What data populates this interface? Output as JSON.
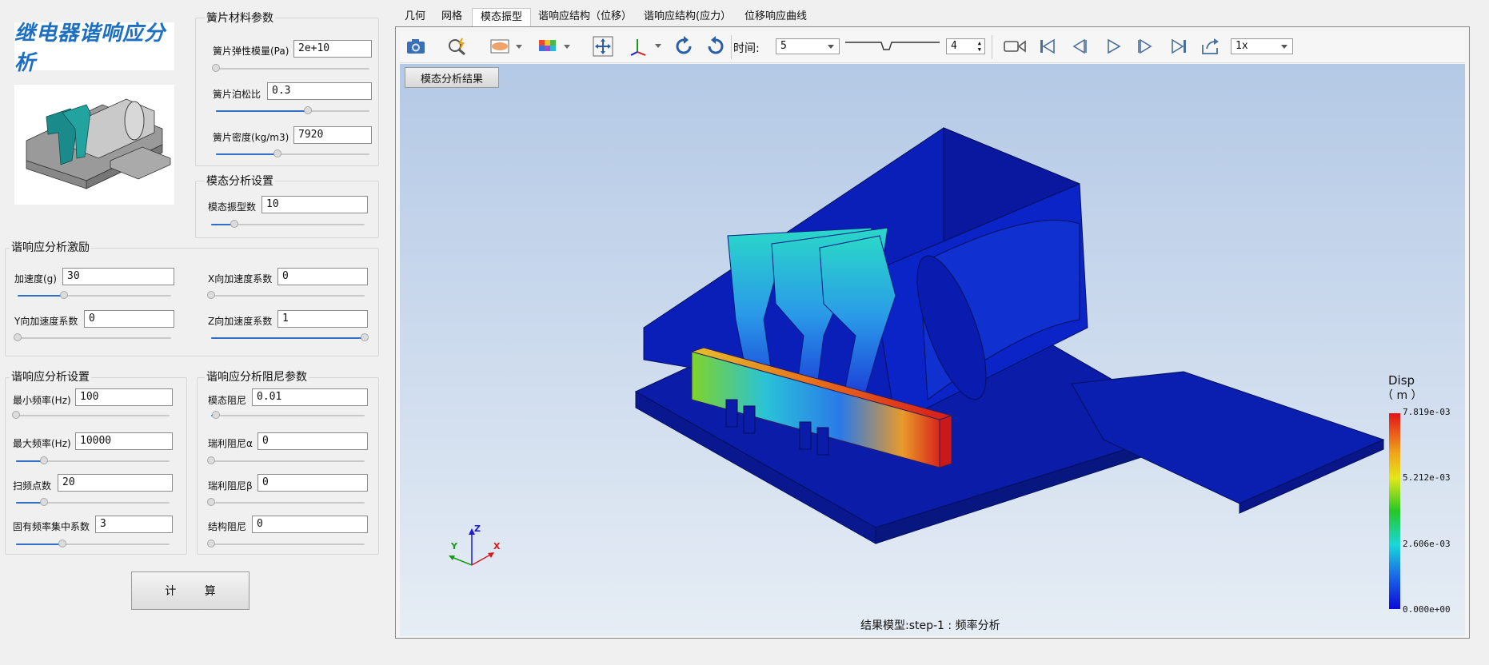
{
  "app": {
    "logo_text": "继电器谐响应分析",
    "calc_label": "计        算"
  },
  "reed": {
    "title": "簧片材料参数",
    "fields": [
      {
        "label": "簧片弹性模量(Pa)",
        "value": "2e+10",
        "level": 0.0
      },
      {
        "label": "簧片泊松比",
        "value": "0.3",
        "level": 0.6
      },
      {
        "label": "簧片密度(kg/m3)",
        "value": "7920",
        "level": 0.4
      }
    ]
  },
  "modal": {
    "title": "模态分析设置",
    "fields": [
      {
        "label": "模态振型数",
        "value": "10",
        "level": 0.15
      }
    ]
  },
  "excite": {
    "title": "谐响应分析激励",
    "fields": [
      {
        "label": "加速度(g)",
        "value": "30",
        "level": 0.3
      },
      {
        "label": "X向加速度系数",
        "value": "0",
        "level": 0.0
      },
      {
        "label": "Y向加速度系数",
        "value": "0",
        "level": 0.0
      },
      {
        "label": "Z向加速度系数",
        "value": "1",
        "level": 1.0
      }
    ]
  },
  "harm": {
    "title": "谐响应分析设置",
    "fields": [
      {
        "label": "最小频率(Hz)",
        "value": "100",
        "level": 0.0
      },
      {
        "label": "最大频率(Hz)",
        "value": "10000",
        "level": 0.18
      },
      {
        "label": "扫频点数",
        "value": "20",
        "level": 0.18
      },
      {
        "label": "固有频率集中系数",
        "value": "3",
        "level": 0.3
      }
    ]
  },
  "damp": {
    "title": "谐响应分析阻尼参数",
    "fields": [
      {
        "label": "模态阻尼",
        "value": "0.01",
        "level": 0.03
      },
      {
        "label": "瑞利阻尼α",
        "value": "0",
        "level": 0.0
      },
      {
        "label": "瑞利阻尼β",
        "value": "0",
        "level": 0.0
      },
      {
        "label": "结构阻尼",
        "value": "0",
        "level": 0.0
      }
    ]
  },
  "tabs": [
    "几何",
    "网格",
    "模态振型",
    "谐响应结构（位移）",
    "谐响应结构(应力）",
    "位移响应曲线"
  ],
  "toolbar": {
    "time_label": "时间:",
    "time_value": "5",
    "step_value": "4",
    "speed_value": "1x"
  },
  "viewer": {
    "result_button": "模态分析结果",
    "caption": "结果模型:step-1 : 频率分析",
    "legend_title": "Disp",
    "legend_unit": "（ m ）",
    "legend_ticks": [
      "7.819e-03",
      "5.212e-03",
      "2.606e-03",
      "0.000e+00"
    ],
    "axis_x": "X",
    "axis_y": "Y",
    "axis_z": "Z"
  },
  "colors": {
    "accent": "#2f6ec2",
    "model_blue": "#0a1fb0",
    "legend_high": "#e4131b",
    "legend_low": "#0a0ad8"
  }
}
